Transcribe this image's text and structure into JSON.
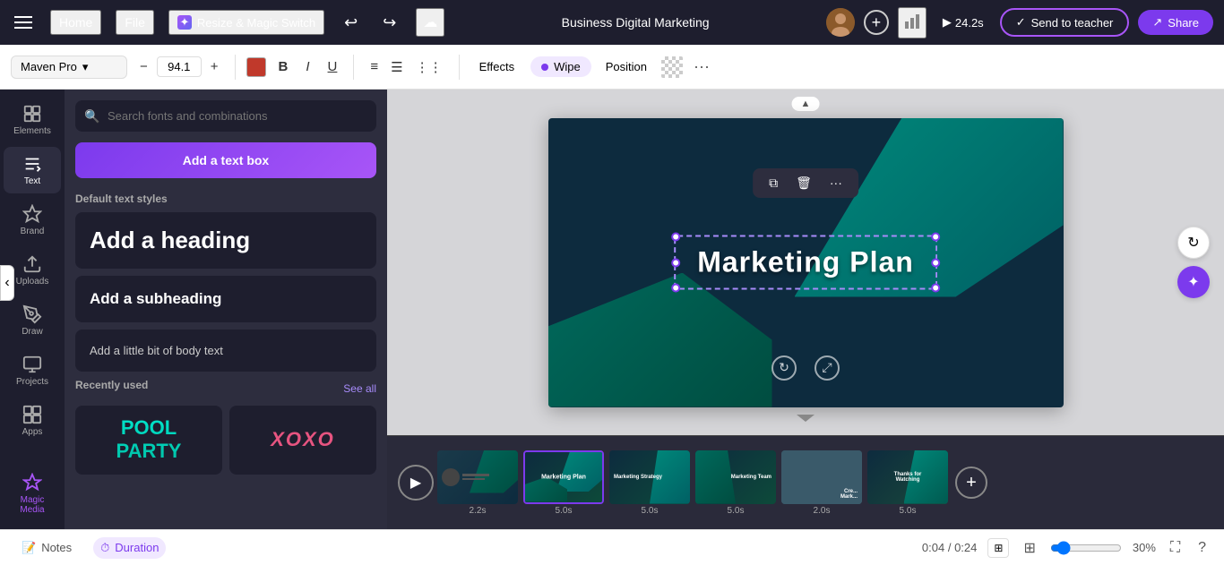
{
  "topbar": {
    "home_label": "Home",
    "file_label": "File",
    "resize_label": "Resize & Magic Switch",
    "doc_title": "Business Digital Marketing",
    "timer": "24.2s",
    "send_teacher_label": "Send to teacher",
    "share_label": "Share"
  },
  "toolbar": {
    "font_name": "Maven Pro",
    "font_size": "94.1",
    "effects_label": "Effects",
    "wipe_label": "Wipe",
    "position_label": "Position",
    "more_icon": "···"
  },
  "sidebar": {
    "items": [
      {
        "id": "elements",
        "label": "Elements"
      },
      {
        "id": "text",
        "label": "Text"
      },
      {
        "id": "brand",
        "label": "Brand"
      },
      {
        "id": "uploads",
        "label": "Uploads"
      },
      {
        "id": "draw",
        "label": "Draw"
      },
      {
        "id": "projects",
        "label": "Projects"
      },
      {
        "id": "apps",
        "label": "Apps"
      },
      {
        "id": "magic-media",
        "label": "Magic Media"
      }
    ]
  },
  "text_panel": {
    "search_placeholder": "Search fonts and combinations",
    "add_text_btn": "Add a text box",
    "section_default": "Default text styles",
    "heading_label": "Add a heading",
    "subheading_label": "Add a subheading",
    "body_label": "Add a little bit of body text",
    "section_recent": "Recently used",
    "see_all_label": "See all",
    "font1_text": "POOL PARTY",
    "font2_text": "XOXO"
  },
  "canvas": {
    "slide_title": "Marketing Plan",
    "overlay_icons": [
      "⧉",
      "🗑",
      "···"
    ]
  },
  "filmstrip": {
    "slides": [
      {
        "id": 1,
        "time": "2.2s",
        "label": ""
      },
      {
        "id": 2,
        "time": "5.0s",
        "label": "Marketing Plan",
        "active": true
      },
      {
        "id": 3,
        "time": "5.0s",
        "label": "Marketing Strategy"
      },
      {
        "id": 4,
        "time": "5.0s",
        "label": "Marketing Team"
      },
      {
        "id": 5,
        "time": "2.0s",
        "label": ""
      },
      {
        "id": 6,
        "time": "5.0s",
        "label": "Thanks for Watching"
      }
    ]
  },
  "statusbar": {
    "notes_label": "Notes",
    "duration_label": "Duration",
    "time_current": "0:04",
    "time_total": "0:24",
    "time_separator": "/",
    "zoom_level": "30%"
  }
}
